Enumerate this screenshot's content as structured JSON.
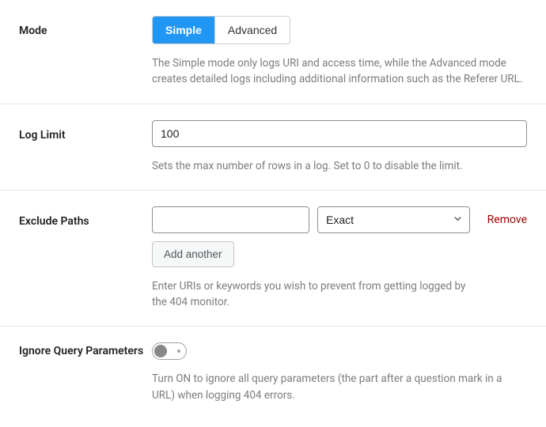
{
  "mode": {
    "label": "Mode",
    "options": {
      "simple": "Simple",
      "advanced": "Advanced"
    },
    "help": "The Simple mode only logs URI and access time, while the Advanced mode creates detailed logs including additional information such as the Referer URL."
  },
  "log_limit": {
    "label": "Log Limit",
    "value": "100",
    "help": "Sets the max number of rows in a log. Set to 0 to disable the limit."
  },
  "exclude_paths": {
    "label": "Exclude Paths",
    "path_value": "",
    "match_selected": "Exact",
    "match_options": [
      "Exact"
    ],
    "remove_label": "Remove",
    "add_label": "Add another",
    "help": "Enter URIs or keywords you wish to prevent from getting logged by the 404 monitor."
  },
  "ignore_query": {
    "label": "Ignore Query Parameters",
    "help": "Turn ON to ignore all query parameters (the part after a question mark in a URL) when logging 404 errors."
  }
}
